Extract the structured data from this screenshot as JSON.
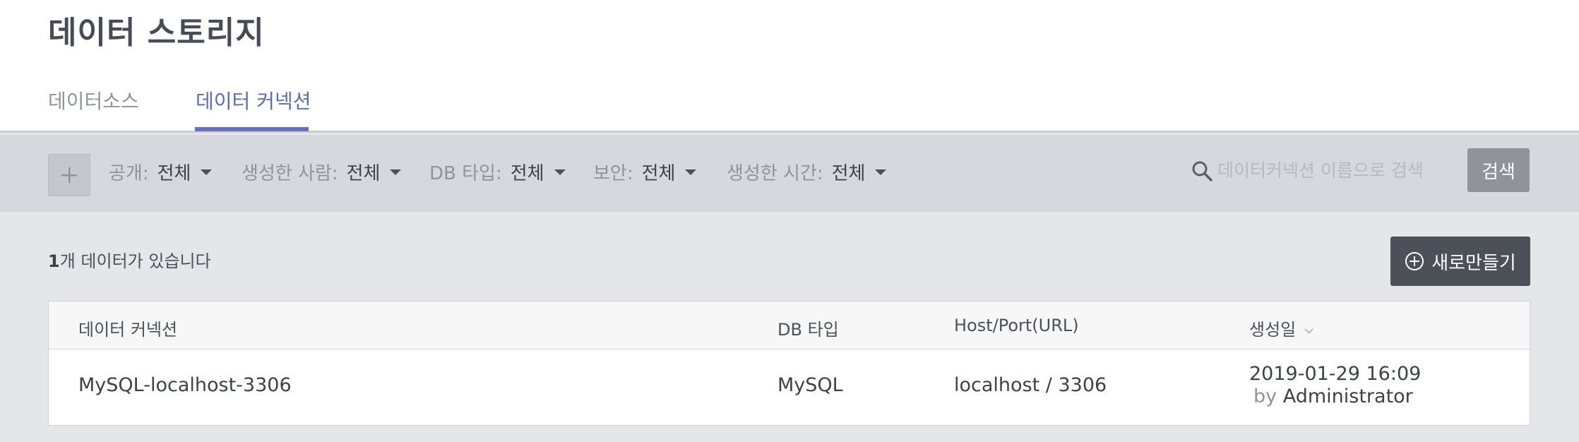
{
  "page": {
    "title": "데이터 스토리지"
  },
  "tabs": [
    {
      "label": "데이터소스",
      "active": false
    },
    {
      "label": "데이터 커넥션",
      "active": true
    }
  ],
  "filters": [
    {
      "label": "공개:",
      "value": "전체"
    },
    {
      "label": "생성한 사람:",
      "value": "전체"
    },
    {
      "label": "DB 타입:",
      "value": "전체"
    },
    {
      "label": "보안:",
      "value": "전체"
    },
    {
      "label": "생성한 시간:",
      "value": "전체"
    }
  ],
  "search": {
    "placeholder": "데이터커넥션 이름으로 검색",
    "button_label": "검색"
  },
  "summary": {
    "count": "1",
    "suffix": "개 데이터가 있습니다"
  },
  "toolbar": {
    "new_label": "새로만들기"
  },
  "table": {
    "columns": [
      "데이터 커넥션",
      "DB 타입",
      "Host/Port(URL)",
      "생성일"
    ],
    "rows": [
      {
        "name": "MySQL-localhost-3306",
        "db_type": "MySQL",
        "host": "localhost / 3306",
        "created_date": "2019-01-29 16:09",
        "by_prefix": "by",
        "created_by": "Administrator"
      }
    ]
  },
  "colors": {
    "accent": "#5e6bb8",
    "header_bg": "#ffffff",
    "filterbar_bg": "#d6d8dd",
    "body_bg": "#e5e6ea",
    "dark_button": "#4c5159",
    "search_button": "#8e939c"
  }
}
